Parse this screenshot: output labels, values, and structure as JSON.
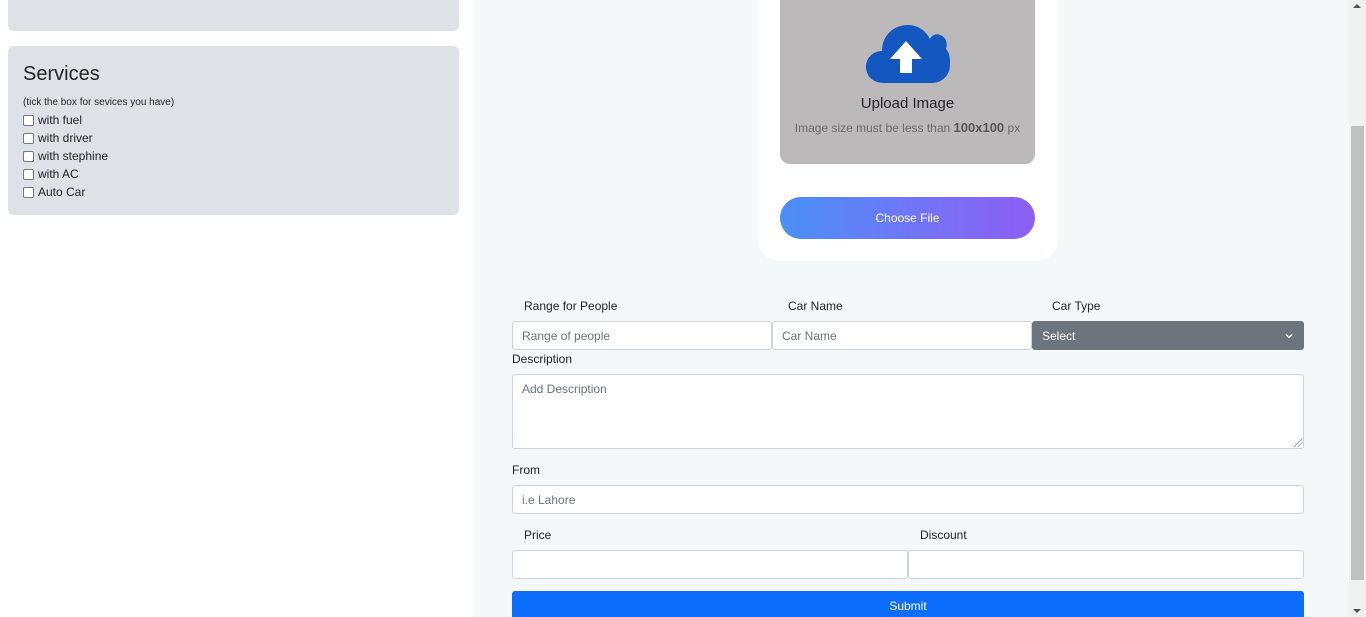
{
  "sidebar": {
    "services": {
      "title": "Services",
      "hint": "(tick the box for sevices you have)",
      "options": [
        {
          "label": "with fuel"
        },
        {
          "label": "with driver"
        },
        {
          "label": "with stephine"
        },
        {
          "label": "with AC"
        },
        {
          "label": "Auto Car"
        }
      ]
    }
  },
  "upload": {
    "title": "Upload Image",
    "hint_prefix": "Image size must be less than",
    "hint_size": "100x100",
    "hint_suffix": "px",
    "choose_label": "Choose File"
  },
  "form": {
    "range_label": "Range for People",
    "range_placeholder": "Range of people",
    "car_name_label": "Car Name",
    "car_name_placeholder": "Car Name",
    "car_type_label": "Car Type",
    "car_type_value": "Select",
    "description_label": "Description",
    "description_placeholder": "Add Description",
    "from_label": "From",
    "from_placeholder": "i.e Lahore",
    "price_label": "Price",
    "discount_label": "Discount",
    "submit_label": "Submit"
  },
  "colors": {
    "accent": "#0d6efd",
    "select_bg": "#6c757d",
    "upload_zone": "#bbb9ba",
    "cloud": "#1557c0",
    "card": "#dee2e6"
  }
}
